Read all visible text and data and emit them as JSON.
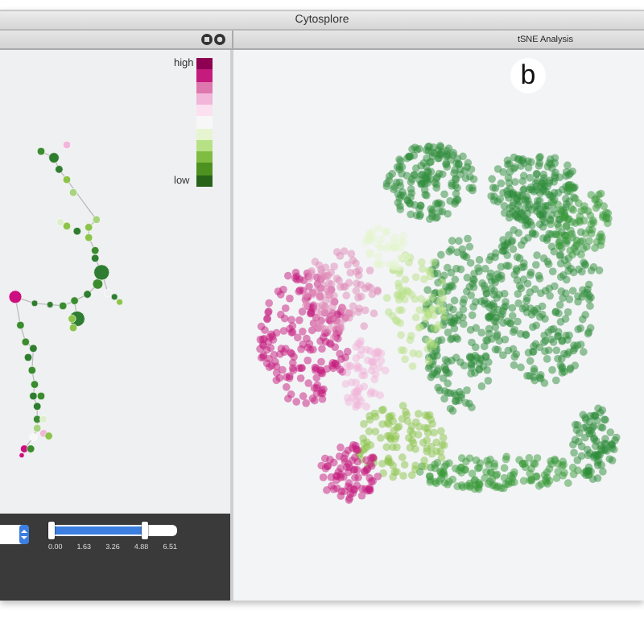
{
  "window": {
    "title": "Cytosplore"
  },
  "left_panel": {
    "legend": {
      "high_label": "high",
      "low_label": "low"
    },
    "range_slider": {
      "level": 0.75,
      "ticks": [
        "0.00",
        "1.63",
        "3.26",
        "4.88",
        "6.51"
      ]
    }
  },
  "right_panel": {
    "title": "tSNE Analysis",
    "badge": "b"
  }
}
